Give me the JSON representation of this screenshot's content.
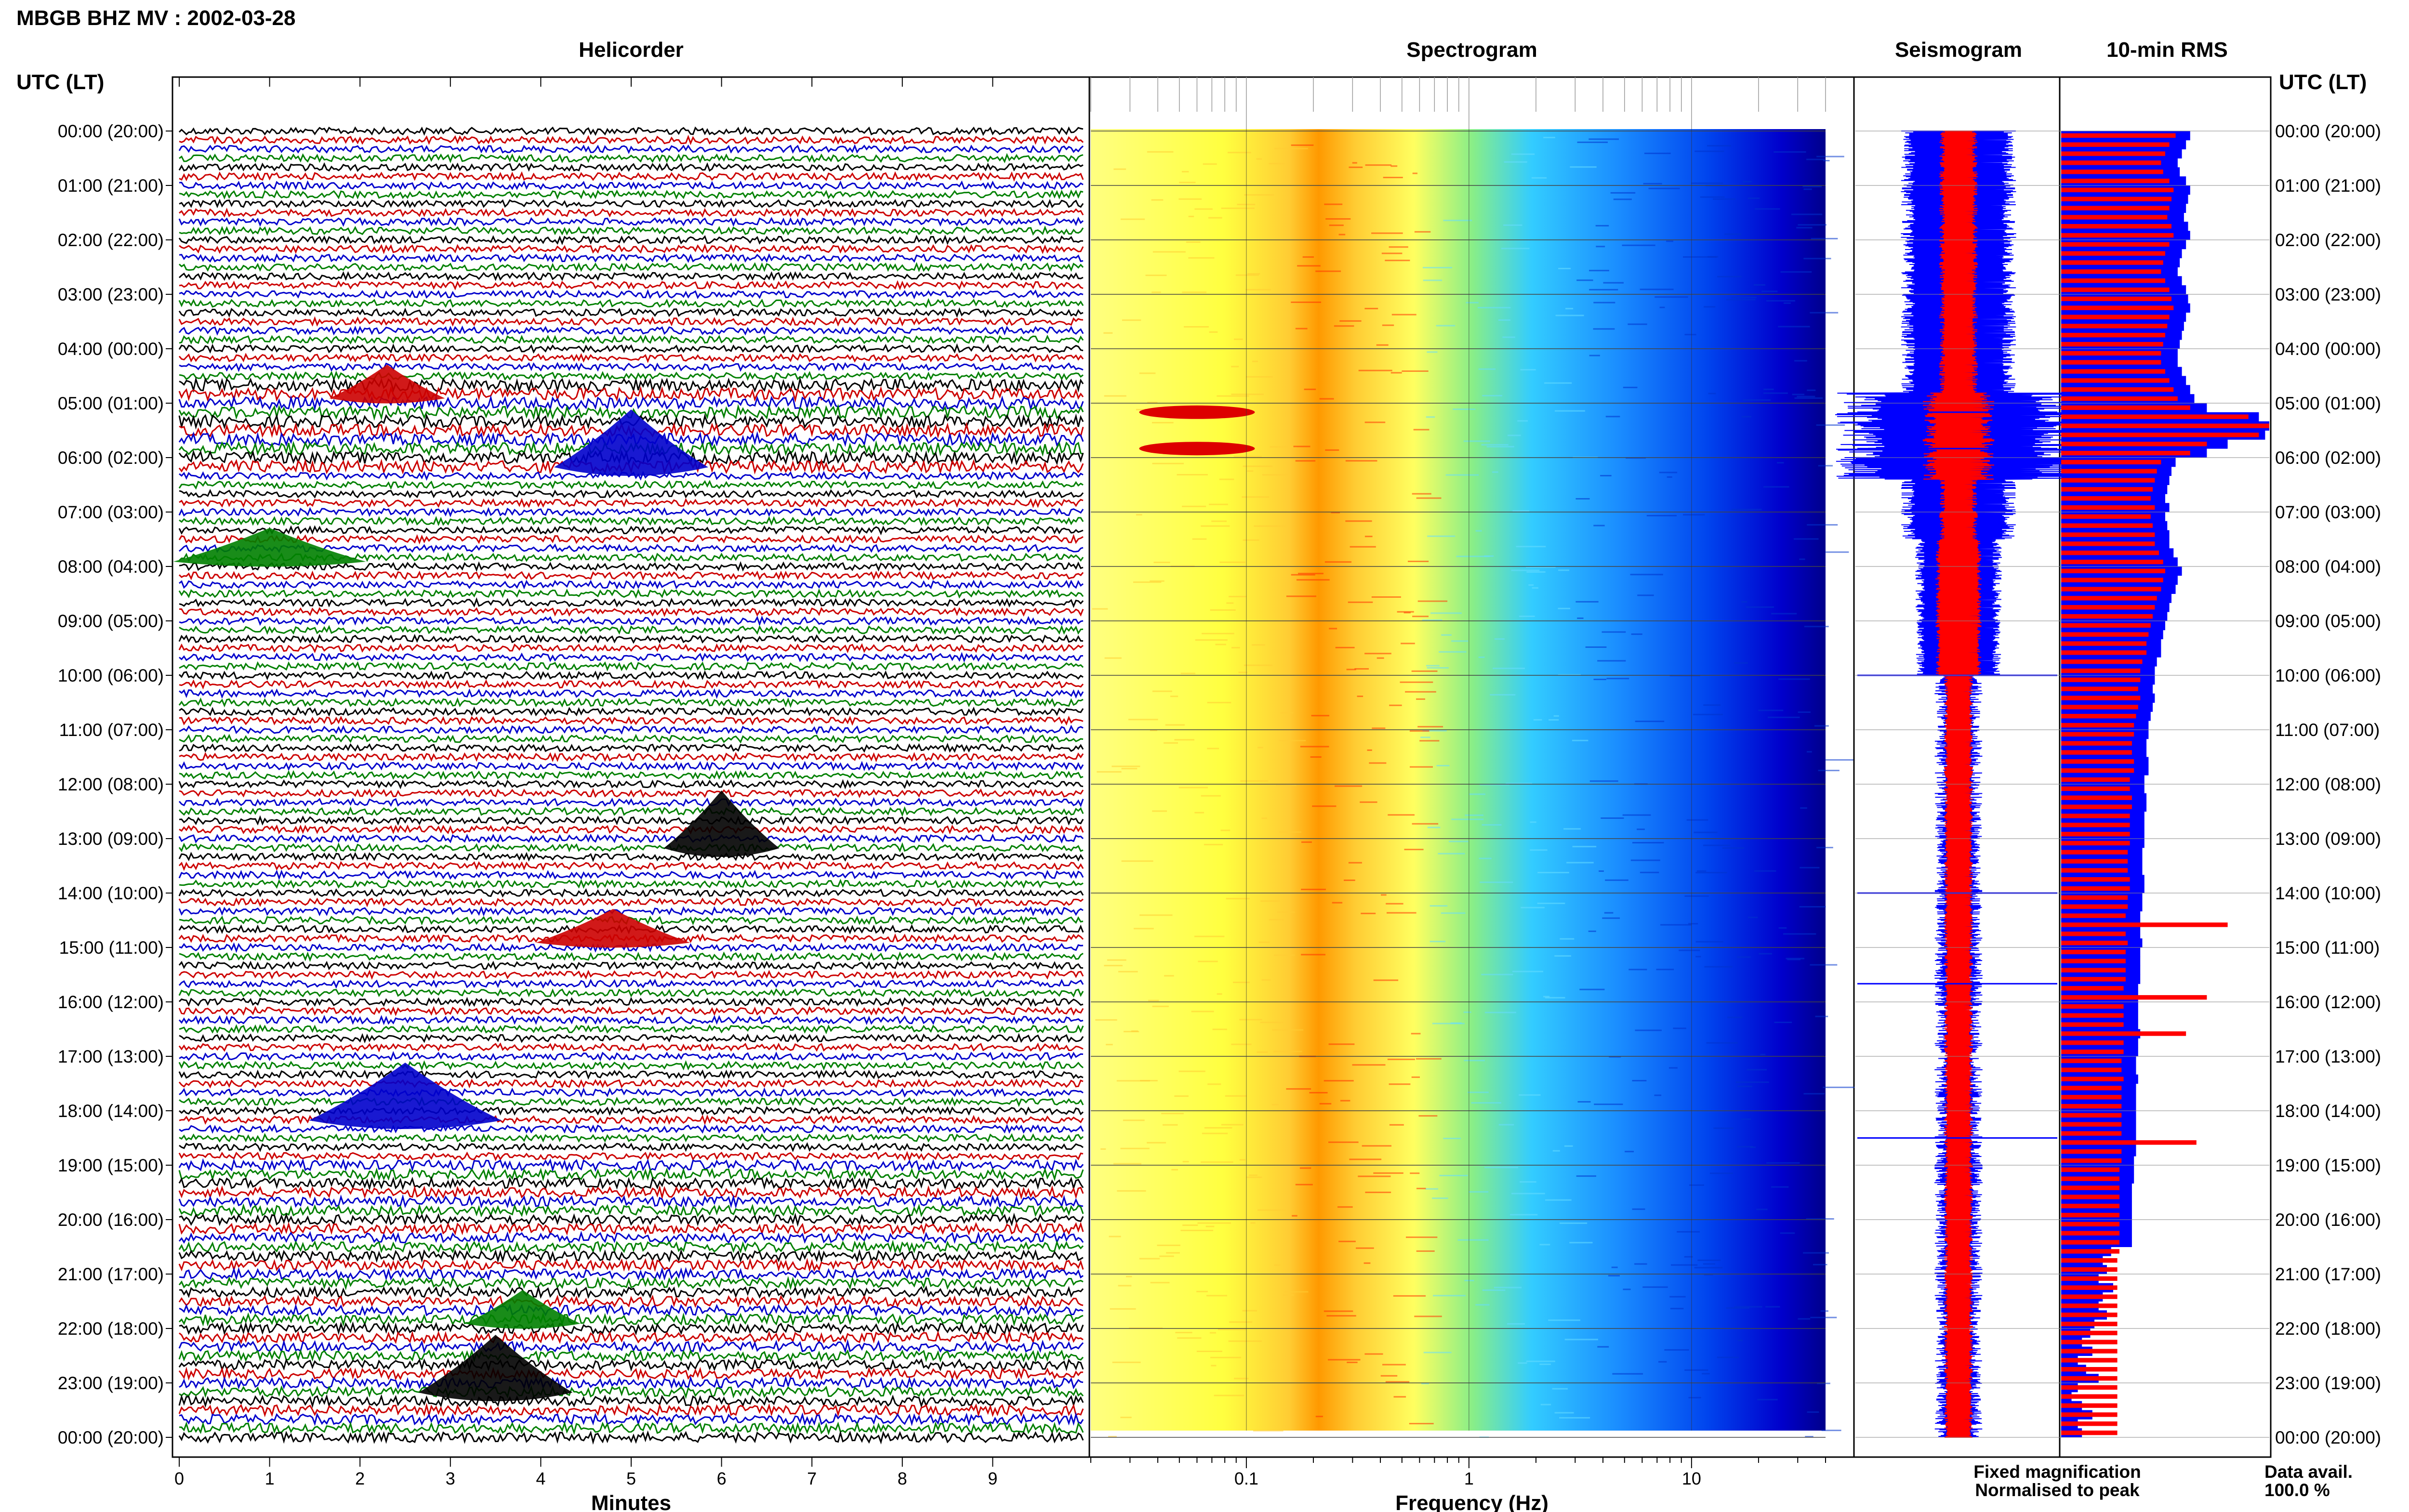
{
  "header": {
    "title": "MBGB BHZ MV : 2002-03-28"
  },
  "time_axis_label": "UTC (LT)",
  "time_ticks": [
    "00:00 (20:00)",
    "01:00 (21:00)",
    "02:00 (22:00)",
    "03:00 (23:00)",
    "04:00 (00:00)",
    "05:00 (01:00)",
    "06:00 (02:00)",
    "07:00 (03:00)",
    "08:00 (04:00)",
    "09:00 (05:00)",
    "10:00 (06:00)",
    "11:00 (07:00)",
    "12:00 (08:00)",
    "13:00 (09:00)",
    "14:00 (10:00)",
    "15:00 (11:00)",
    "16:00 (12:00)",
    "17:00 (13:00)",
    "18:00 (14:00)",
    "19:00 (15:00)",
    "20:00 (16:00)",
    "21:00 (17:00)",
    "22:00 (18:00)",
    "23:00 (19:00)",
    "00:00 (20:00)"
  ],
  "panels": {
    "helicorder": {
      "title": "Helicorder",
      "xlabel": "Minutes",
      "xticks": [
        "0",
        "1",
        "2",
        "3",
        "4",
        "5",
        "6",
        "7",
        "8",
        "9"
      ],
      "trace_colors": [
        "#000000",
        "#cc0000",
        "#0000cc",
        "#008000"
      ]
    },
    "spectrogram": {
      "title": "Spectrogram",
      "xlabel": "Frequency (Hz)",
      "xticks": [
        "0.1",
        "1",
        "10"
      ]
    },
    "seismogram": {
      "title": "Seismogram"
    },
    "rms": {
      "title": "10-min RMS"
    }
  },
  "legend": {
    "fixed": "Fixed magnification",
    "fixed_color": "#0000ff",
    "normalised": "Normalised to peak",
    "normalised_color": "#ff0000"
  },
  "data_availability": {
    "label": "Data avail.",
    "value": "100.0 %"
  },
  "chart_data": [
    {
      "type": "line",
      "title": "Helicorder",
      "xlabel": "Minutes",
      "xlim": [
        0,
        10
      ],
      "rows_per_hour": 6,
      "row_minutes": 10,
      "trace_colors": [
        "#000000",
        "#cc0000",
        "#0000cc",
        "#008000"
      ],
      "events": [
        {
          "time_utc": "05:00",
          "minute": 2.3
        },
        {
          "time_utc": "06:00",
          "minute": 5.0
        },
        {
          "time_utc": "08:00",
          "minute": 1.0
        },
        {
          "time_utc": "13:00",
          "minute": 6.0
        },
        {
          "time_utc": "15:00",
          "minute": 4.8
        },
        {
          "time_utc": "18:00",
          "minute": 2.5
        },
        {
          "time_utc": "22:00",
          "minute": 3.8
        },
        {
          "time_utc": "23:00",
          "minute": 3.5
        }
      ]
    },
    {
      "type": "heatmap",
      "title": "Spectrogram",
      "xlabel": "Frequency (Hz)",
      "x_scale": "log",
      "xlim": [
        0.02,
        40
      ],
      "colormap": [
        "#ffff66",
        "#ffcc33",
        "#ff6600",
        "#ff0000",
        "#33ccff",
        "#0066ff",
        "#0000cc"
      ],
      "dominant_band_hz": [
        0.2,
        0.5
      ],
      "strong_events_utc": [
        "05:10",
        "05:50"
      ]
    },
    {
      "type": "area",
      "title": "Seismogram",
      "series": [
        {
          "name": "Fixed magnification",
          "color": "#0000ff"
        },
        {
          "name": "Normalised to peak",
          "color": "#ff0000"
        }
      ],
      "spikes_utc": [
        "05:10",
        "05:50",
        "10:00",
        "14:00",
        "15:40",
        "18:30"
      ]
    },
    {
      "type": "bar",
      "title": "10-min RMS",
      "x_interval_minutes": 10,
      "series": [
        {
          "name": "Fixed magnification",
          "color": "#0000ff"
        },
        {
          "name": "Normalised to peak",
          "color": "#ff0000"
        }
      ],
      "fixed_magnification_rel": [
        0.62,
        0.6,
        0.58,
        0.56,
        0.57,
        0.6,
        0.62,
        0.61,
        0.6,
        0.59,
        0.61,
        0.62,
        0.6,
        0.58,
        0.57,
        0.56,
        0.58,
        0.6,
        0.61,
        0.62,
        0.6,
        0.59,
        0.58,
        0.57,
        0.56,
        0.56,
        0.58,
        0.6,
        0.62,
        0.64,
        0.7,
        0.95,
        1.0,
        0.98,
        0.8,
        0.7,
        0.55,
        0.53,
        0.52,
        0.51,
        0.5,
        0.52,
        0.5,
        0.51,
        0.52,
        0.52,
        0.54,
        0.56,
        0.58,
        0.56,
        0.55,
        0.53,
        0.52,
        0.51,
        0.5,
        0.49,
        0.48,
        0.48,
        0.46,
        0.45,
        0.45,
        0.44,
        0.45,
        0.44,
        0.43,
        0.42,
        0.42,
        0.41,
        0.41,
        0.42,
        0.42,
        0.4,
        0.4,
        0.41,
        0.41,
        0.4,
        0.4,
        0.4,
        0.4,
        0.39,
        0.39,
        0.39,
        0.4,
        0.4,
        0.39,
        0.39,
        0.38,
        0.38,
        0.38,
        0.39,
        0.38,
        0.38,
        0.38,
        0.38,
        0.37,
        0.37,
        0.37,
        0.37,
        0.37,
        0.38,
        0.37,
        0.37,
        0.36,
        0.36,
        0.37,
        0.36,
        0.36,
        0.36,
        0.36,
        0.36,
        0.36,
        0.36,
        0.36,
        0.35,
        0.35,
        0.35,
        0.34,
        0.34,
        0.34,
        0.34,
        0.34,
        0.34,
        0.34,
        0.24,
        0.2,
        0.22,
        0.18,
        0.25,
        0.2,
        0.18,
        0.22,
        0.16,
        0.14,
        0.1,
        0.15,
        0.08,
        0.12,
        0.18,
        0.08,
        0.05,
        0.1,
        0.15,
        0.08,
        0.1
      ],
      "normalised_rel": [
        0.55,
        0.52,
        0.5,
        0.48,
        0.49,
        0.52,
        0.54,
        0.53,
        0.52,
        0.51,
        0.53,
        0.54,
        0.52,
        0.5,
        0.49,
        0.48,
        0.5,
        0.52,
        0.53,
        0.54,
        0.52,
        0.51,
        0.5,
        0.49,
        0.48,
        0.48,
        0.5,
        0.52,
        0.54,
        0.56,
        0.62,
        0.9,
        1.0,
        0.95,
        0.7,
        0.62,
        0.48,
        0.46,
        0.45,
        0.44,
        0.43,
        0.45,
        0.43,
        0.44,
        0.45,
        0.45,
        0.47,
        0.49,
        0.5,
        0.49,
        0.48,
        0.46,
        0.45,
        0.44,
        0.43,
        0.42,
        0.41,
        0.41,
        0.39,
        0.38,
        0.38,
        0.37,
        0.38,
        0.37,
        0.36,
        0.35,
        0.35,
        0.34,
        0.34,
        0.35,
        0.35,
        0.33,
        0.33,
        0.34,
        0.34,
        0.33,
        0.33,
        0.33,
        0.33,
        0.32,
        0.32,
        0.32,
        0.33,
        0.33,
        0.32,
        0.32,
        0.31,
        0.8,
        0.31,
        0.32,
        0.31,
        0.31,
        0.31,
        0.31,
        0.3,
        0.7,
        0.3,
        0.3,
        0.3,
        0.6,
        0.3,
        0.3,
        0.29,
        0.29,
        0.3,
        0.29,
        0.29,
        0.29,
        0.29,
        0.29,
        0.29,
        0.65,
        0.29,
        0.29,
        0.28,
        0.28,
        0.28,
        0.28,
        0.28,
        0.28,
        0.28,
        0.28,
        0.28,
        0.28,
        0.27,
        0.27,
        0.27,
        0.27,
        0.27,
        0.27,
        0.27,
        0.27,
        0.27,
        0.27,
        0.27,
        0.27,
        0.27,
        0.27,
        0.27,
        0.27,
        0.27,
        0.27,
        0.27,
        0.27
      ]
    }
  ]
}
